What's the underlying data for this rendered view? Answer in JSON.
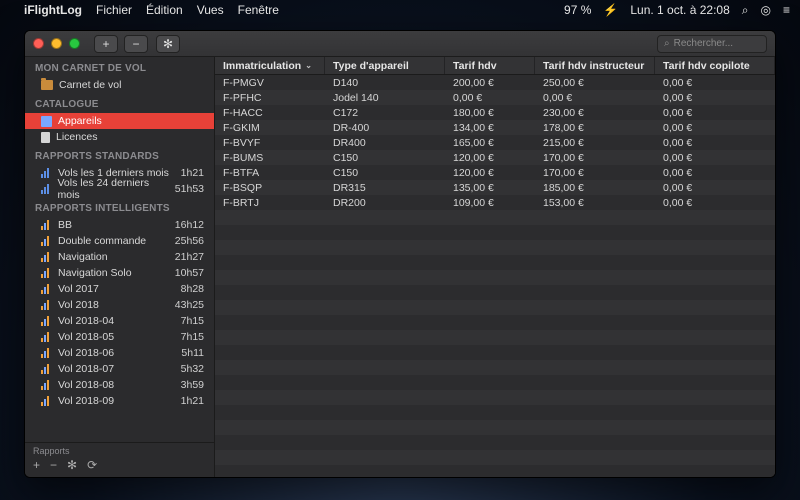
{
  "menubar": {
    "apple": "",
    "app": "iFlightLog",
    "items": [
      "Fichier",
      "Édition",
      "Vues",
      "Fenêtre"
    ],
    "right": {
      "bt": "",
      "wifi": "",
      "battery_pct": "97 %",
      "battery_icon": "⚡",
      "datetime": "Lun. 1 oct. à 22:08",
      "search": "⌕",
      "siri": "◎",
      "menu": "≡"
    }
  },
  "toolbar": {
    "add": "+",
    "remove": "−",
    "settings": "✻",
    "search_icon": "⌕",
    "search_placeholder": "Rechercher..."
  },
  "sidebar": {
    "sections": [
      {
        "title": "MON CARNET DE VOL",
        "items": [
          {
            "icon": "folder",
            "label": "Carnet de vol"
          }
        ]
      },
      {
        "title": "CATALOGUE",
        "items": [
          {
            "icon": "cube",
            "label": "Appareils",
            "selected": true
          },
          {
            "icon": "doc",
            "label": "Licences"
          }
        ]
      },
      {
        "title": "RAPPORTS STANDARDS",
        "items": [
          {
            "icon": "bars-blue",
            "label": "Vols les 1 derniers mois",
            "badge": "1h21"
          },
          {
            "icon": "bars-blue",
            "label": "Vols les 24 derniers mois",
            "badge": "51h53"
          }
        ]
      },
      {
        "title": "RAPPORTS INTELLIGENTS",
        "items": [
          {
            "icon": "bars",
            "label": "BB",
            "badge": "16h12"
          },
          {
            "icon": "bars",
            "label": "Double commande",
            "badge": "25h56"
          },
          {
            "icon": "bars",
            "label": "Navigation",
            "badge": "21h27"
          },
          {
            "icon": "bars",
            "label": "Navigation Solo",
            "badge": "10h57"
          },
          {
            "icon": "bars",
            "label": "Vol 2017",
            "badge": "8h28"
          },
          {
            "icon": "bars",
            "label": "Vol 2018",
            "badge": "43h25"
          },
          {
            "icon": "bars",
            "label": "Vol 2018-04",
            "badge": "7h15"
          },
          {
            "icon": "bars",
            "label": "Vol 2018-05",
            "badge": "7h15"
          },
          {
            "icon": "bars",
            "label": "Vol 2018-06",
            "badge": "5h11"
          },
          {
            "icon": "bars",
            "label": "Vol 2018-07",
            "badge": "5h32"
          },
          {
            "icon": "bars",
            "label": "Vol 2018-08",
            "badge": "3h59"
          },
          {
            "icon": "bars",
            "label": "Vol 2018-09",
            "badge": "1h21"
          }
        ]
      }
    ],
    "footer": {
      "label": "Rapports",
      "add": "+",
      "remove": "−",
      "gear": "✻",
      "refresh": "⟳"
    }
  },
  "table": {
    "columns": [
      "Immatriculation",
      "Type d'appareil",
      "Tarif hdv",
      "Tarif hdv instructeur",
      "Tarif hdv copilote"
    ],
    "sort_col": 0,
    "sort_indicator": "⌄",
    "rows": [
      {
        "c": [
          "F-PMGV",
          "D140",
          "200,00 €",
          "250,00 €",
          "0,00 €"
        ]
      },
      {
        "c": [
          "F-PFHC",
          "Jodel 140",
          "0,00 €",
          "0,00 €",
          "0,00 €"
        ]
      },
      {
        "c": [
          "F-HACC",
          "C172",
          "180,00 €",
          "230,00 €",
          "0,00 €"
        ]
      },
      {
        "c": [
          "F-GKIM",
          "DR-400",
          "134,00 €",
          "178,00 €",
          "0,00 €"
        ]
      },
      {
        "c": [
          "F-BVYF",
          "DR400",
          "165,00 €",
          "215,00 €",
          "0,00 €"
        ]
      },
      {
        "c": [
          "F-BUMS",
          "C150",
          "120,00 €",
          "170,00 €",
          "0,00 €"
        ]
      },
      {
        "c": [
          "F-BTFA",
          "C150",
          "120,00 €",
          "170,00 €",
          "0,00 €"
        ]
      },
      {
        "c": [
          "F-BSQP",
          "DR315",
          "135,00 €",
          "185,00 €",
          "0,00 €"
        ]
      },
      {
        "c": [
          "F-BRTJ",
          "DR200",
          "109,00 €",
          "153,00 €",
          "0,00 €"
        ]
      }
    ],
    "empty_rows": 18
  }
}
